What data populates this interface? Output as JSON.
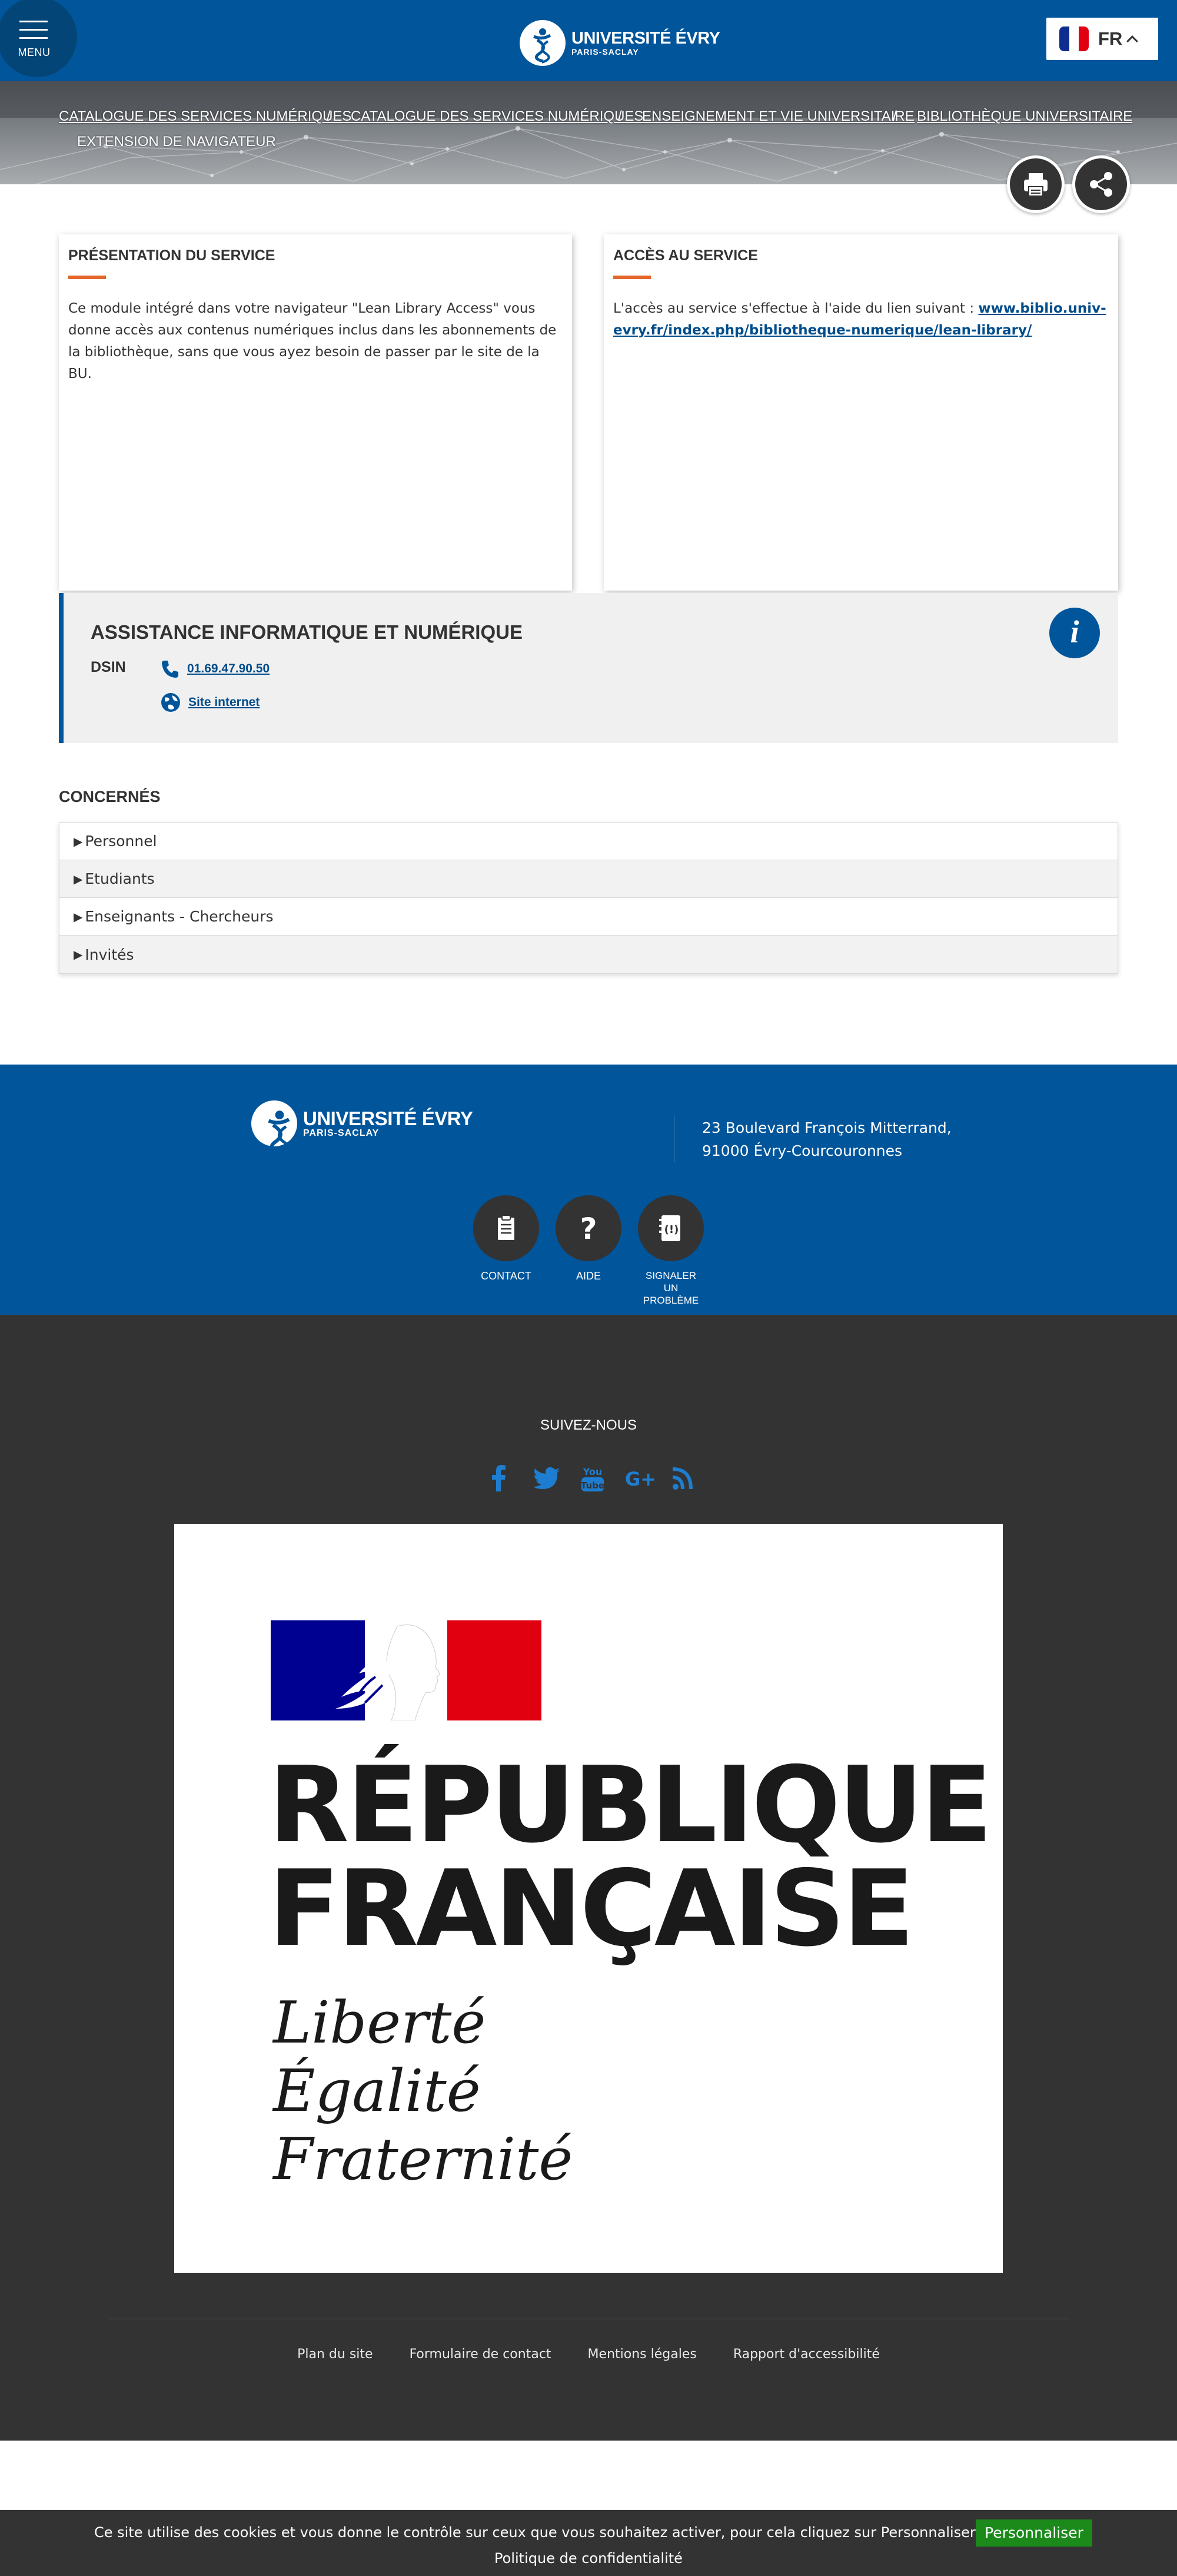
{
  "header": {
    "menu_label": "MENU",
    "logo_line1": "UNIVERSITÉ ÉVRY",
    "logo_line2": "PARIS-SACLAY",
    "language_code": "FR",
    "brand_color": "#00559b"
  },
  "breadcrumb": {
    "items": [
      "CATALOGUE DES SERVICES NUMÉRIQUES",
      "CATALOGUE DES SERVICES NUMÉRIQUES",
      "ENSEIGNEMENT ET VIE UNIVERSITAIRE",
      "BIBLIOTHÈQUE UNIVERSITAIRE"
    ],
    "separator": "/",
    "current": "EXTENSION DE NAVIGATEUR"
  },
  "actions": {
    "print_icon": "printer-icon",
    "share_icon": "share-icon"
  },
  "presentation": {
    "title": "PRÉSENTATION DU SERVICE",
    "text": "Ce module intégré dans votre navigateur \"Lean Library Access\" vous donne accès aux contenus numériques inclus dans les abonnements de la bibliothèque, sans que vous ayez besoin de passer par le site de la BU."
  },
  "access": {
    "title": "ACCÈS AU SERVICE",
    "text": "L'accès au service s'effectue à l'aide du lien suivant : ",
    "link": "www.biblio.univ-evry.fr/index.php/bibliotheque-numerique/lean-library/"
  },
  "assistance": {
    "title": "ASSISTANCE INFORMATIQUE ET NUMÉRIQUE",
    "org": "DSIN",
    "phone": "01.69.47.90.50",
    "website": "Site internet",
    "info_icon": "info-icon"
  },
  "concernes": {
    "title": "CONCERNÉS",
    "items": [
      "Personnel",
      "Etudiants",
      "Enseignants - Chercheurs",
      "Invités"
    ]
  },
  "footer": {
    "logo_line1": "UNIVERSITÉ ÉVRY",
    "logo_line2": "PARIS-SACLAY",
    "address_line1": "23 Boulevard François Mitterrand,",
    "address_line2": "91000 Évry-Courcouronnes",
    "quick_links": [
      "CONTACT",
      "AIDE",
      "SIGNALER UN PROBLÈME"
    ],
    "follow_us": "SUIVEZ-NOUS",
    "socials": [
      "facebook-icon",
      "twitter-icon",
      "youtube-icon",
      "google-plus-icon",
      "rss-icon"
    ],
    "republique": {
      "line1": "RÉPUBLIQUE",
      "line2": "FRANÇAISE",
      "motto1": "Liberté",
      "motto2": "Égalité",
      "motto3": "Fraternité"
    },
    "links": [
      "Plan du site",
      "Formulaire de contact",
      "Mentions légales",
      "Rapport d'accessibilité"
    ]
  },
  "cookie": {
    "message": "Ce site utilise des cookies et vous donne le contrôle sur ceux que vous souhaitez activer, pour cela cliquez sur Personnaliser",
    "button": "Personnaliser",
    "policy": "Politique de confidentialité"
  }
}
